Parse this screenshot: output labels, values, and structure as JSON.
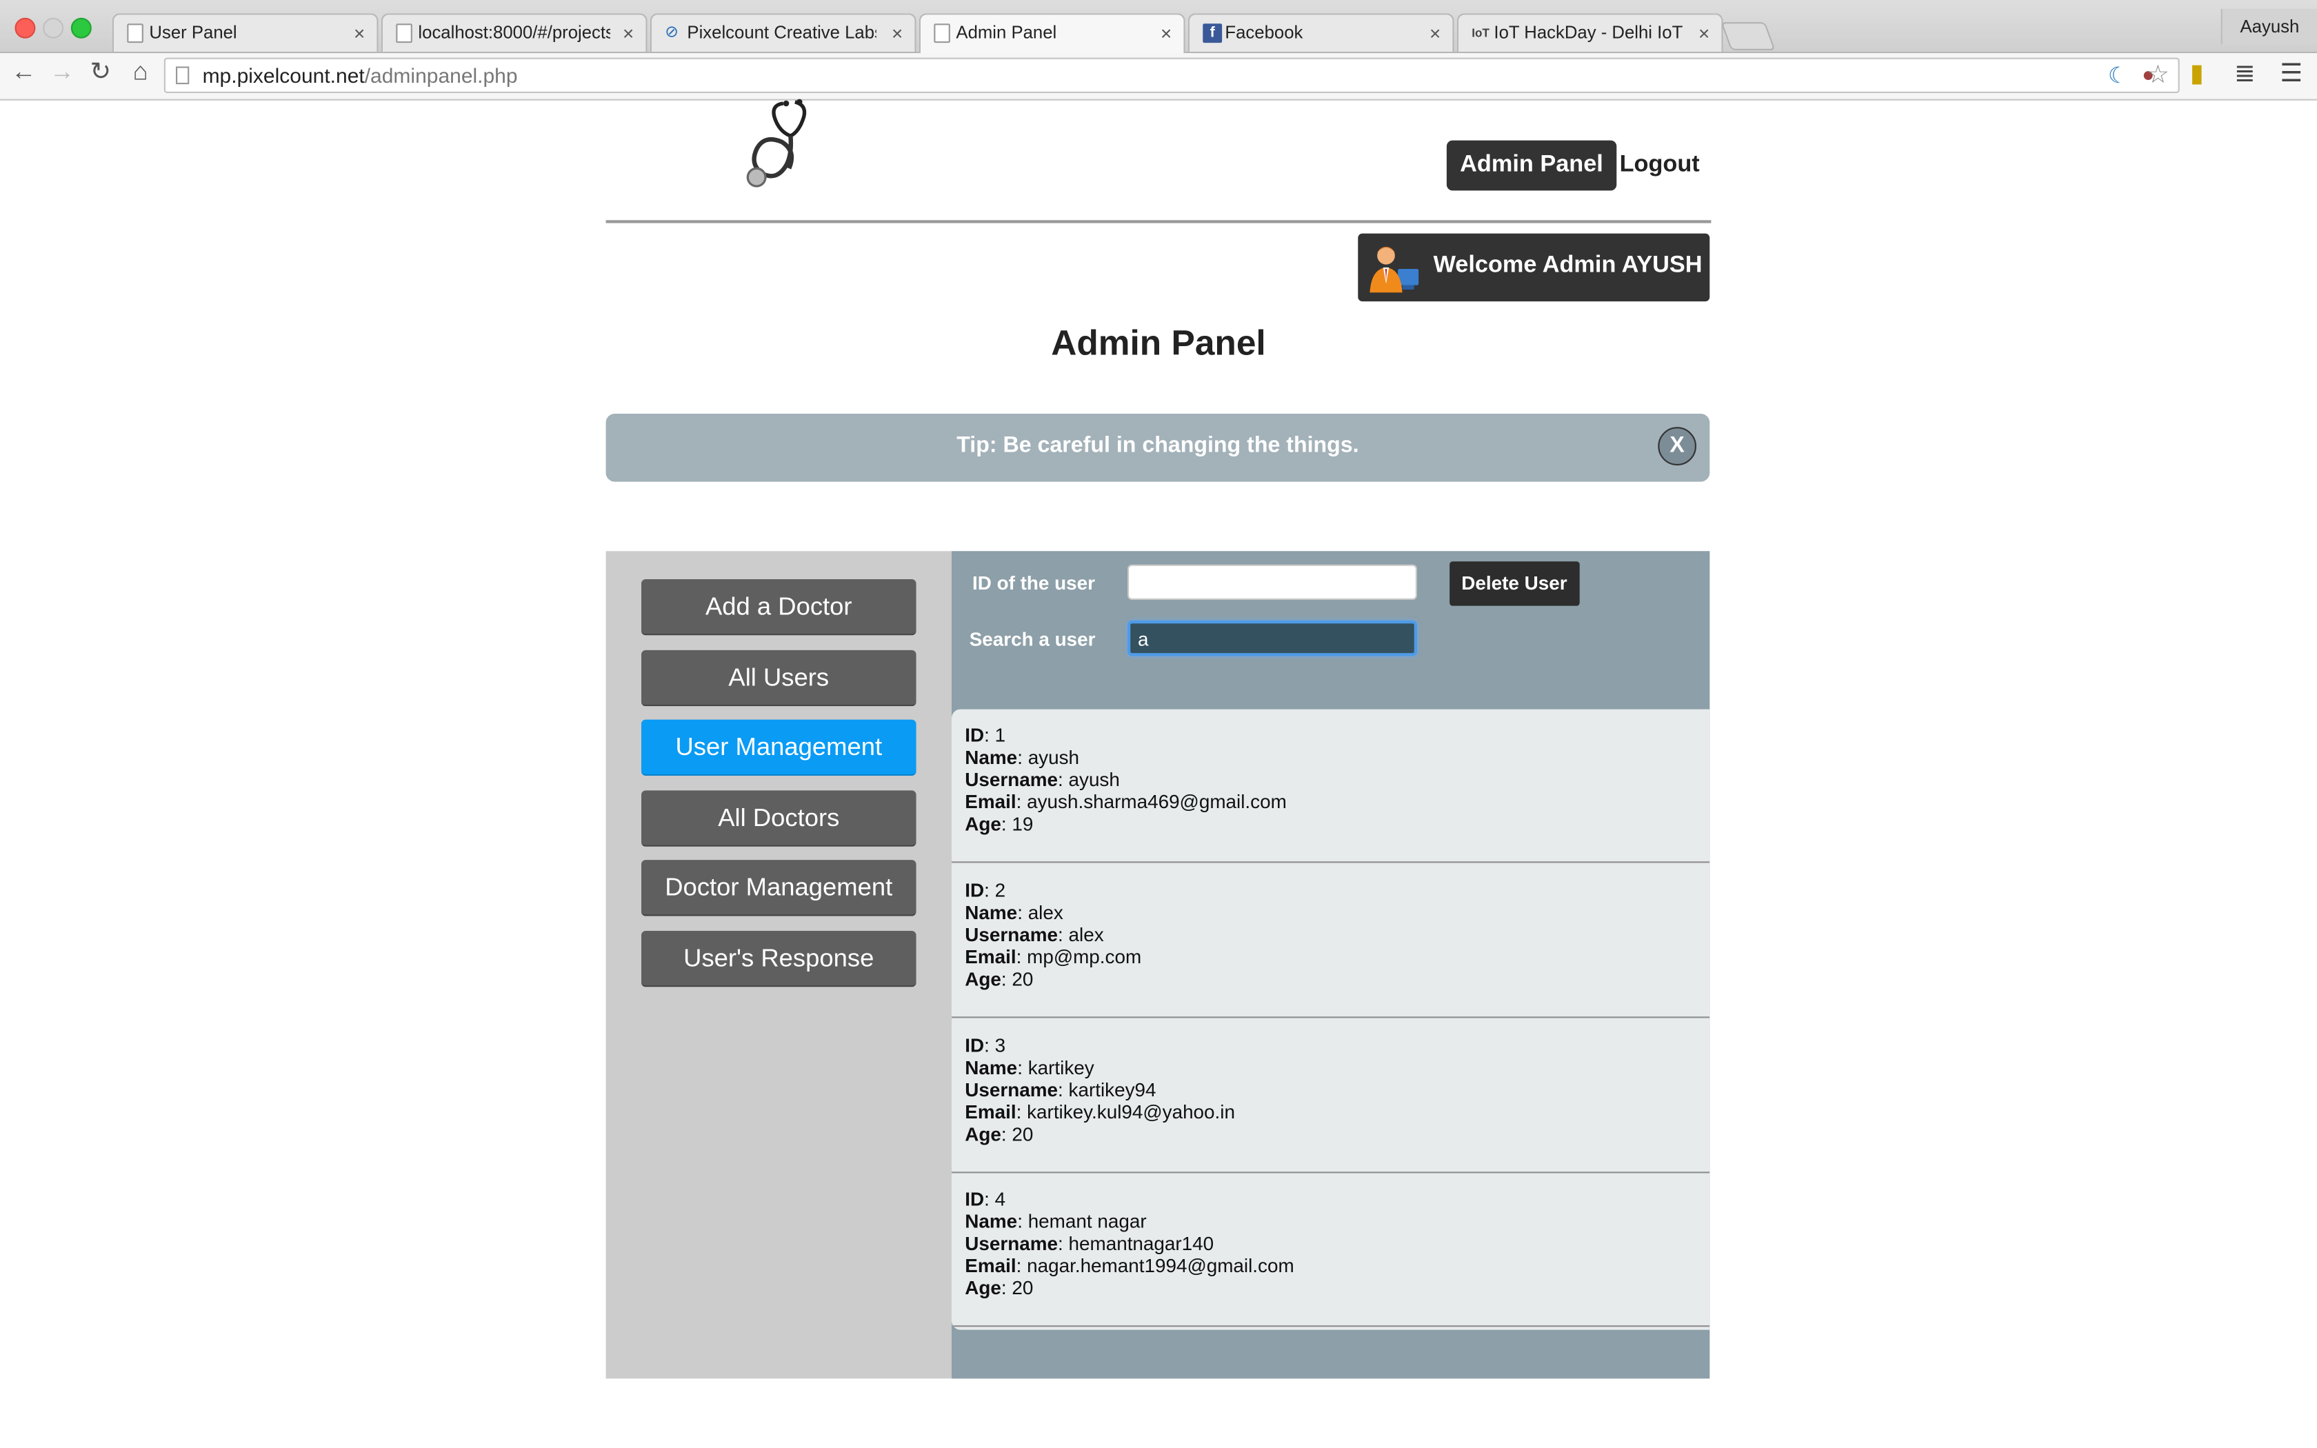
{
  "browser": {
    "tabs": [
      {
        "title": "User Panel",
        "icon": "page-icon",
        "active": false
      },
      {
        "title": "localhost:8000/#/projects/",
        "icon": "page-icon",
        "active": false
      },
      {
        "title": "Pixelcount Creative Labs |",
        "icon": "pixelcount-icon",
        "active": false
      },
      {
        "title": "Admin Panel",
        "icon": "page-icon",
        "active": true
      },
      {
        "title": "Facebook",
        "icon": "facebook-icon",
        "active": false
      },
      {
        "title": "IoT HackDay - Delhi IoT and",
        "icon": "iot-icon",
        "active": false
      }
    ],
    "profile": "Aayush",
    "url_host": "mp.pixelcount.net",
    "url_path": "/adminpanel.php"
  },
  "header": {
    "admin_panel_link": "Admin Panel",
    "logout_link": "Logout",
    "welcome": "Welcome Admin AYUSH"
  },
  "page_title": "Admin Panel",
  "tip": {
    "text": "Tip: Be careful in changing the things.",
    "close": "X"
  },
  "sidebar": {
    "items": [
      {
        "label": "Add a Doctor",
        "active": false
      },
      {
        "label": "All Users",
        "active": false
      },
      {
        "label": "User Management",
        "active": true
      },
      {
        "label": "All Doctors",
        "active": false
      },
      {
        "label": "Doctor Management",
        "active": false
      },
      {
        "label": "User's Response",
        "active": false
      }
    ]
  },
  "form": {
    "id_label": "ID of the user",
    "id_value": "",
    "delete_label": "Delete User",
    "search_label": "Search a user",
    "search_value": "a"
  },
  "field_labels": {
    "id": "ID",
    "name": "Name",
    "username": "Username",
    "email": "Email",
    "age": "Age"
  },
  "users": [
    {
      "id": "1",
      "name": "ayush",
      "username": "ayush",
      "email": "ayush.sharma469@gmail.com",
      "age": "19"
    },
    {
      "id": "2",
      "name": "alex",
      "username": "alex",
      "email": "mp@mp.com",
      "age": "20"
    },
    {
      "id": "3",
      "name": "kartikey",
      "username": "kartikey94",
      "email": "kartikey.kul94@yahoo.in",
      "age": "20"
    },
    {
      "id": "4",
      "name": "hemant nagar",
      "username": "hemantnagar140",
      "email": "nagar.hemant1994@gmail.com",
      "age": "20"
    }
  ],
  "colors": {
    "active_nav": "#0a9bf5",
    "sidebar_button": "#5f5f5f",
    "content_bg": "#8d9fa8",
    "tip_bg": "#a3b1b9"
  }
}
